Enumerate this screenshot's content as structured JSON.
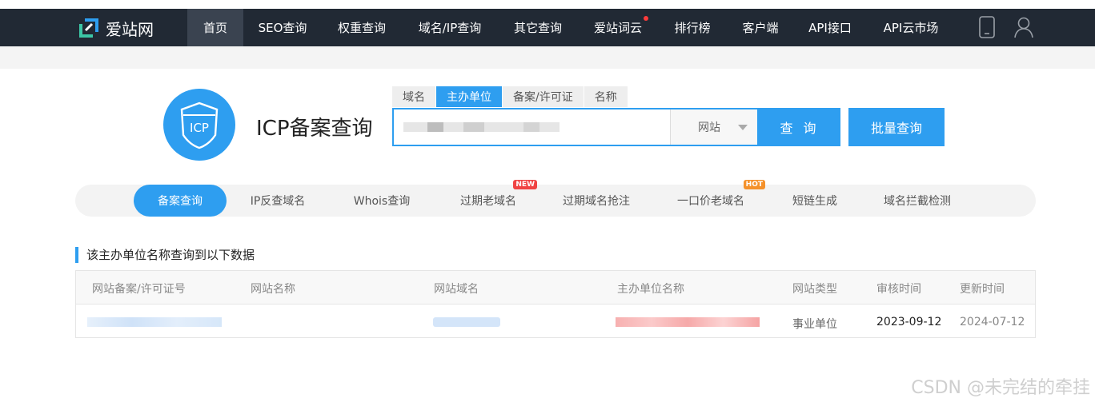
{
  "nav": {
    "logo_text": "爱站网",
    "items": [
      {
        "label": "首页",
        "active": true
      },
      {
        "label": "SEO查询"
      },
      {
        "label": "权重查询"
      },
      {
        "label": "域名/IP查询"
      },
      {
        "label": "其它查询"
      },
      {
        "label": "爱站词云",
        "dot": true
      },
      {
        "label": "排行榜"
      },
      {
        "label": "客户端"
      },
      {
        "label": "API接口"
      },
      {
        "label": "API云市场"
      }
    ]
  },
  "icp": {
    "title": "ICP备案查询",
    "tabs": [
      {
        "label": "域名"
      },
      {
        "label": "主办单位",
        "active": true
      },
      {
        "label": "备案/许可证"
      },
      {
        "label": "名称"
      }
    ],
    "select_value": "网站",
    "query_button": "查 询",
    "batch_button": "批量查询"
  },
  "subnav": [
    {
      "label": "备案查询",
      "active": true
    },
    {
      "label": "IP反查域名"
    },
    {
      "label": "Whois查询"
    },
    {
      "label": "过期老域名",
      "tag": "NEW"
    },
    {
      "label": "过期域名抢注"
    },
    {
      "label": "一口价老域名",
      "tag": "HOT"
    },
    {
      "label": "短链生成"
    },
    {
      "label": "域名拦截检测"
    }
  ],
  "result": {
    "title": "该主办单位名称查询到以下数据",
    "columns": [
      "网站备案/许可证号",
      "网站名称",
      "网站域名",
      "主办单位名称",
      "网站类型",
      "审核时间",
      "更新时间"
    ],
    "rows": [
      {
        "type": "事业单位",
        "audit": "2023-09-12",
        "updated": "2024-07-12"
      }
    ]
  },
  "watermark": "CSDN @未完结的牵挂",
  "colors": {
    "accent": "#2e9ef0",
    "topbar": "#212934"
  }
}
